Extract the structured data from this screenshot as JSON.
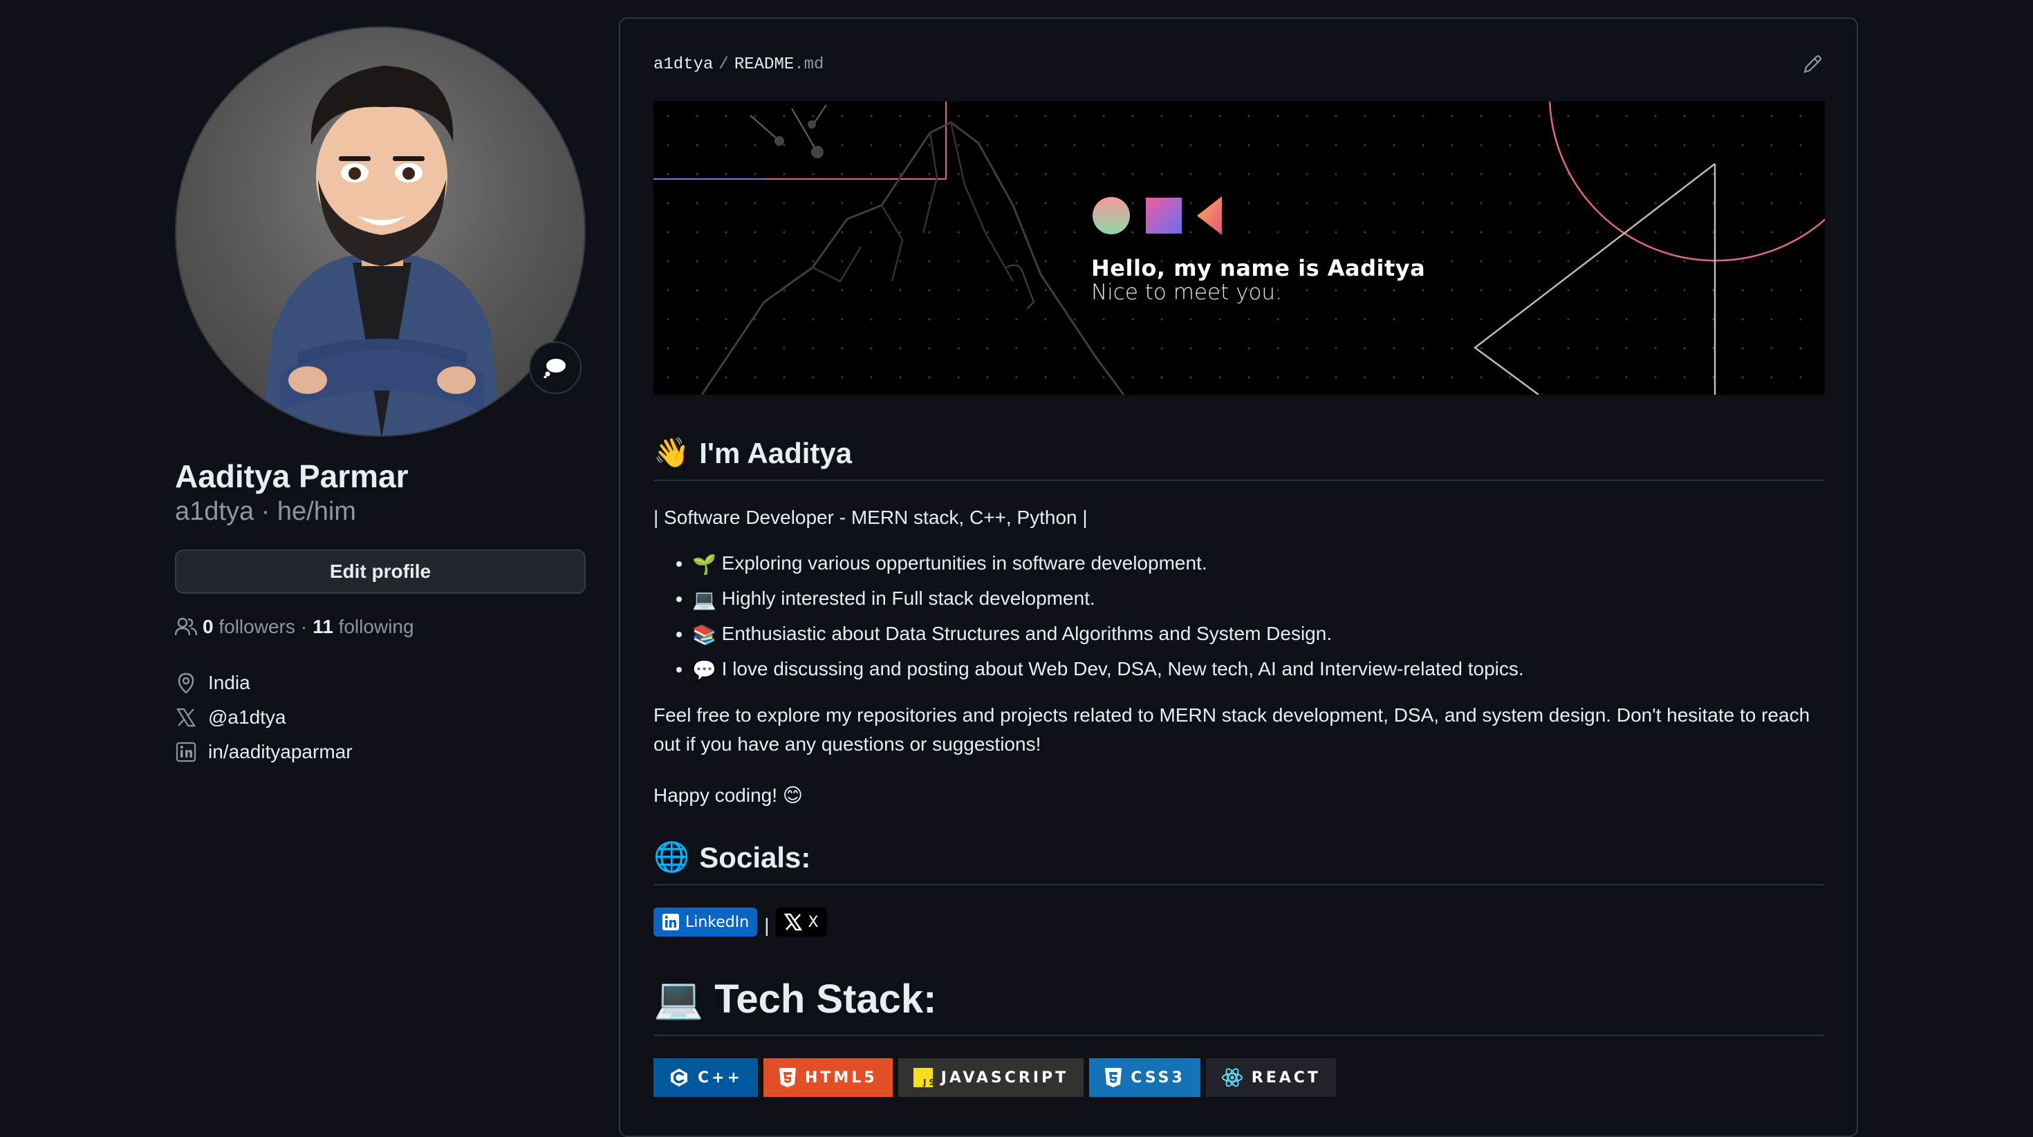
{
  "profile": {
    "full_name": "Aaditya Parmar",
    "login_line": "a1dtya · he/him",
    "edit_label": "Edit profile",
    "followers_count": "0",
    "followers_label": "followers",
    "dot": "·",
    "following_count": "11",
    "following_label": "following",
    "details": {
      "location": "India",
      "x_handle": "@a1dtya",
      "linkedin": "in/aadityaparmar"
    }
  },
  "readme": {
    "user": "a1dtya",
    "separator": "/",
    "file": "README",
    "ext": ".md",
    "banner": {
      "title": "Hello, my name is Aaditya",
      "subtitle": "Nice to meet you."
    },
    "intro_heading": "I'm Aaditya",
    "intro_emoji": "👋",
    "tagline": "| Software Developer - MERN stack, C++, Python |",
    "bullets": [
      {
        "emoji": "🌱",
        "text": "Exploring various oppertunities in software development."
      },
      {
        "emoji": "💻",
        "text": "Highly interested in Full stack development."
      },
      {
        "emoji": "📚",
        "text": "Enthusiastic about Data Structures and Algorithms and System Design."
      },
      {
        "emoji": "💬",
        "text": "I love discussing and posting about Web Dev, DSA, New tech, AI and Interview-related topics."
      }
    ],
    "paragraph": "Feel free to explore my repositories and projects related to MERN stack development, DSA, and system design. Don't hesitate to reach out if you have any questions or suggestions!",
    "happy": "Happy coding! 😊",
    "socials_heading": "Socials:",
    "socials_emoji": "🌐",
    "social_badges": {
      "linkedin": "LinkedIn",
      "divider": "|",
      "x": "X"
    },
    "tech_heading": "Tech Stack:",
    "tech_emoji": "💻",
    "tech_badges": [
      {
        "label": "C++",
        "color": "#00599c"
      },
      {
        "label": "HTML5",
        "color": "#e34f26"
      },
      {
        "label": "JAVASCRIPT",
        "color": "#323330"
      },
      {
        "label": "CSS3",
        "color": "#1572b6"
      },
      {
        "label": "REACT",
        "color": "#20232a"
      }
    ]
  }
}
